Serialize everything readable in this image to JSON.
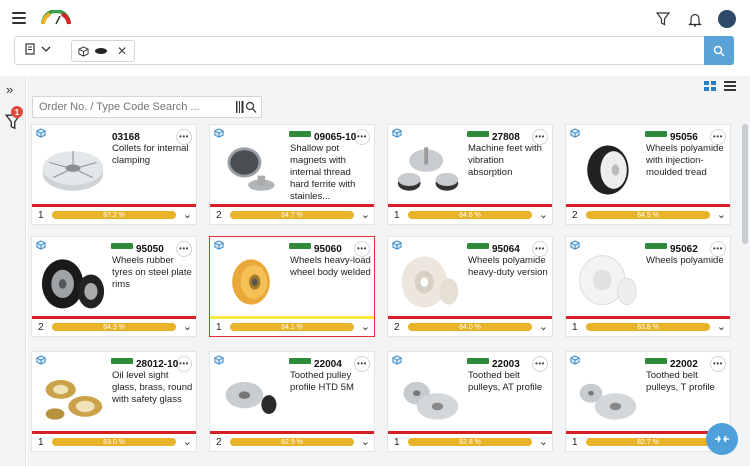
{
  "header": {
    "icons": [
      "menu-icon",
      "app-logo",
      "filter-icon",
      "bell-icon",
      "avatar"
    ]
  },
  "search": {
    "type_icon": "document-icon",
    "chip_icons": [
      "cube-icon",
      "disk-icon"
    ],
    "button_icon": "search-icon"
  },
  "rail": {
    "filter_badge": "1"
  },
  "order_search": {
    "placeholder": "Order No. / Type Code Search ..."
  },
  "cards": [
    {
      "code": "03168",
      "desc": "Collets for internal clamping",
      "count": "1",
      "progress": "87.2 %",
      "brand": false
    },
    {
      "code": "09065-10",
      "desc": "Shallow pot magnets with internal thread hard ferrite with stainles...",
      "count": "2",
      "progress": "84.7 %",
      "brand": true
    },
    {
      "code": "27808",
      "desc": "Machine feet with vibration absorption",
      "count": "1",
      "progress": "84.6 %",
      "brand": true
    },
    {
      "code": "95056",
      "desc": "Wheels polyamide with injection-moulded tread",
      "count": "2",
      "progress": "84.5 %",
      "brand": true
    },
    {
      "code": "95050",
      "desc": "Wheels rubber tyres on steel plate rims",
      "count": "2",
      "progress": "84.3 %",
      "brand": true
    },
    {
      "code": "95060",
      "desc": "Wheels heavy-load wheel body welded",
      "count": "1",
      "progress": "84.1 %",
      "brand": true
    },
    {
      "code": "95064",
      "desc": "Wheels polyamide heavy-duty version",
      "count": "2",
      "progress": "84.0 %",
      "brand": true
    },
    {
      "code": "95062",
      "desc": "Wheels polyamide",
      "count": "1",
      "progress": "83.8 %",
      "brand": true
    },
    {
      "code": "28012-10",
      "desc": "Oil level sight glass, brass, round with safety glass",
      "count": "1",
      "progress": "83.0 %",
      "brand": true
    },
    {
      "code": "22004",
      "desc": "Toothed pulley profile HTD 5M",
      "count": "2",
      "progress": "82.9 %",
      "brand": true
    },
    {
      "code": "22003",
      "desc": "Toothed belt pulleys, AT profile",
      "count": "1",
      "progress": "82.8 %",
      "brand": true
    },
    {
      "code": "22002",
      "desc": "Toothed belt pulleys, T profile",
      "count": "1",
      "progress": "82.7 %",
      "brand": true
    }
  ],
  "selected_card": "95060",
  "colors": {
    "accent": "#4fa0da",
    "progress": "#e8b328",
    "status_line": "#d81f26",
    "selected_border": "#e03030",
    "brand_green": "#2f8a3a"
  }
}
